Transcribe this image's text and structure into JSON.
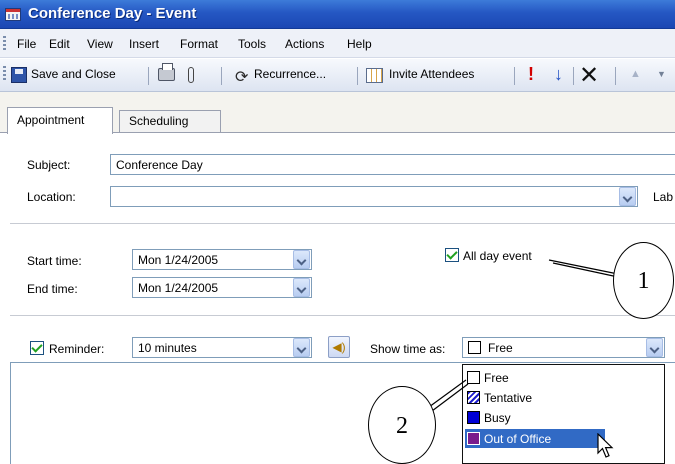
{
  "window": {
    "title": "Conference Day - Event"
  },
  "menu": [
    "File",
    "Edit",
    "View",
    "Insert",
    "Format",
    "Tools",
    "Actions",
    "Help"
  ],
  "toolbar": {
    "save_close": "Save and Close",
    "recurrence": "Recurrence...",
    "invite": "Invite Attendees"
  },
  "tabs": [
    "Appointment",
    "Scheduling"
  ],
  "form": {
    "subject_label": "Subject:",
    "subject_value": "Conference Day",
    "location_label": "Location:",
    "location_value": "",
    "label_cut": "Lab",
    "start_label": "Start time:",
    "start_value": "Mon 1/24/2005",
    "end_label": "End time:",
    "end_value": "Mon 1/24/2005",
    "all_day_label": "All day event",
    "all_day_checked": true,
    "reminder_label": "Reminder:",
    "reminder_checked": true,
    "reminder_value": "10 minutes",
    "show_time_label": "Show time as:",
    "show_time_value": "Free"
  },
  "show_time_options": [
    {
      "label": "Free",
      "swatch": "#ffffff"
    },
    {
      "label": "Tentative",
      "swatch": "hatched-blue"
    },
    {
      "label": "Busy",
      "swatch": "#0000d6"
    },
    {
      "label": "Out of Office",
      "swatch": "#7a1c8c"
    }
  ],
  "selected_option": "Out of Office",
  "callouts": [
    "1",
    "2"
  ],
  "colors": {
    "title_bar": "#2557c3",
    "highlight": "#316ac5",
    "check": "#21a121"
  }
}
